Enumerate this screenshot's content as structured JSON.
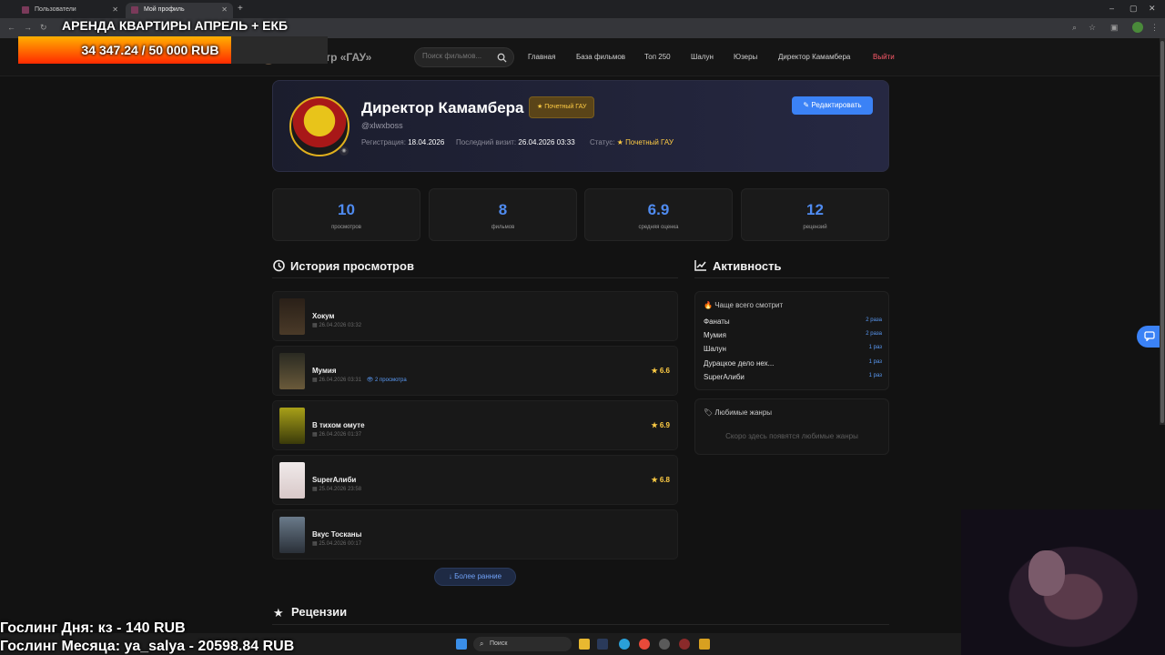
{
  "browser": {
    "tabs": [
      {
        "label": "Пользователи",
        "active": false
      },
      {
        "label": "Мой профиль",
        "active": true
      }
    ],
    "new_tab": "+"
  },
  "overlay": {
    "title": "АРЕНДА КВАРТИРЫ АПРЕЛЬ + ЕКБ",
    "goal_text": "34 347.24 / 50 000 RUB",
    "goal_progress": 0.687,
    "gosling_day": "Гослинг Дня: кз - 140 RUB",
    "gosling_month": "Гослинг Месяца: ya_salya - 20598.84 RUB"
  },
  "header": {
    "brand": "Кинотеатр «ГАУ»",
    "search_placeholder": "Поиск фильмов...",
    "nav": [
      "Главная",
      "База фильмов",
      "Топ 250",
      "Шалун",
      "Юзеры",
      "Директор Камамбера"
    ],
    "logout": "Выйти"
  },
  "profile": {
    "name": "Директор Камамбера",
    "badge": "Почетный ГАУ",
    "handle": "@xlwxboss",
    "reg_label": "Регистрация:",
    "reg_value": "18.04.2026",
    "visit_label": "Последний визит:",
    "visit_value": "26.04.2026 03:33",
    "status_label": "Статус:",
    "status_value": "Почетный ГАУ",
    "edit_button": "Редактировать"
  },
  "stats": [
    {
      "value": "10",
      "label": "просмотров"
    },
    {
      "value": "8",
      "label": "фильмов"
    },
    {
      "value": "6.9",
      "label": "средняя оценка"
    },
    {
      "value": "12",
      "label": "рецензий"
    }
  ],
  "history": {
    "title": "История просмотров",
    "items": [
      {
        "title": "Хокум",
        "date": "26.04.2026 03:32",
        "views": "",
        "rating": "",
        "poster_color": "#3a2a1a"
      },
      {
        "title": "Мумия",
        "date": "26.04.2026 03:31",
        "views": "2 просмотра",
        "rating": "6.6",
        "poster_color": "#5a4a2a"
      },
      {
        "title": "В тихом омуте",
        "date": "26.04.2026 01:37",
        "views": "",
        "rating": "6.9",
        "poster_color": "#8a8a1a"
      },
      {
        "title": "SuperАлиби",
        "date": "25.04.2026 23:58",
        "views": "",
        "rating": "6.8",
        "poster_color": "#e8e0e0"
      },
      {
        "title": "Вкус Тосканы",
        "date": "25.04.2026 00:17",
        "views": "",
        "rating": "",
        "poster_color": "#4a5a6a"
      }
    ],
    "more_button": "Более ранние"
  },
  "activity": {
    "title": "Активность",
    "frequent_title": "Чаще всего смотрит",
    "frequent": [
      {
        "name": "Фанаты",
        "count": "2 раза"
      },
      {
        "name": "Мумия",
        "count": "2 раза"
      },
      {
        "name": "Шалун",
        "count": "1 раз"
      },
      {
        "name": "Дурацкое дело нех...",
        "count": "1 раз"
      },
      {
        "name": "SuperАлиби",
        "count": "1 раз"
      }
    ],
    "genres_title": "Любимые жанры",
    "genres_empty": "Скоро здесь появятся любимые жанры"
  },
  "reviews": {
    "title": "Рецензии"
  },
  "taskbar": {
    "search_label": "Поиск"
  },
  "colors": {
    "accent": "#3b82f6",
    "gold": "#ffcc44",
    "logout": "#ff5a6a"
  }
}
